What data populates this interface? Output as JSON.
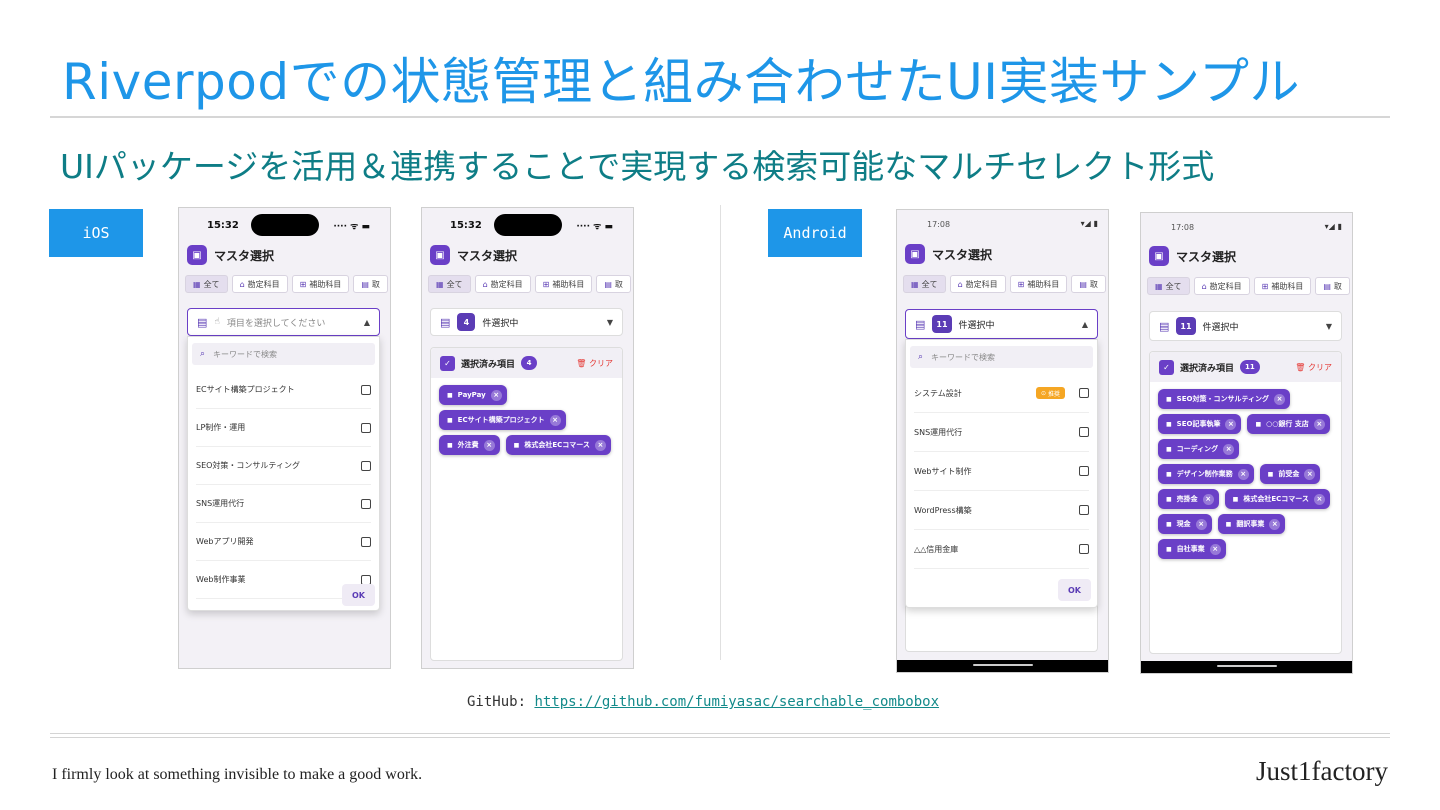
{
  "slide": {
    "title": "Riverpodでの状態管理と組み合わせたUI実装サンプル",
    "subtitle": "UIパッケージを活用＆連携することで実現する検索可能なマルチセレクト形式",
    "ios_label": "iOS",
    "android_label": "Android",
    "github_prefix": "GitHub: ",
    "github_link": "https://github.com/fumiyasac/searchable_combobox",
    "tagline": "I firmly look at something invisible to make a good work.",
    "brand": "Just1factory"
  },
  "app": {
    "title": "マスタ選択",
    "app_icon": "wallet-icon",
    "tabs": [
      {
        "icon": "grid-icon",
        "glyph": "▦",
        "label": "全て"
      },
      {
        "icon": "bank-icon",
        "glyph": "⌂",
        "label": "勘定科目"
      },
      {
        "icon": "hierarchy-icon",
        "glyph": "⊞",
        "label": "補助科目"
      },
      {
        "icon": "store-icon",
        "glyph": "▤",
        "label": "取"
      }
    ],
    "placeholder": "項目を選択してください",
    "search_placeholder": "キーワードで検索",
    "selected_suffix": "件選択中",
    "ok_label": "OK",
    "panel_title": "選択済み項目",
    "clear_label": "クリア",
    "recommend_badge": "推奨",
    "accent_color": "#6a3fc7"
  },
  "screens": {
    "ios_open": {
      "time": "15:32",
      "status_icons": "···· ᯤ ▬",
      "items": [
        "ECサイト構築プロジェクト",
        "LP制作・運用",
        "SEO対策・コンサルティング",
        "SNS運用代行",
        "Webアプリ開発",
        "Web制作事業"
      ]
    },
    "ios_selected": {
      "time": "15:32",
      "status_icons": "···· ᯤ ▬",
      "count": "4",
      "chips": [
        "PayPay",
        "ECサイト構築プロジェクト",
        "外注費",
        "株式会社ECコマース"
      ]
    },
    "android_open": {
      "time": "17:08",
      "status_icons": "▾◢ ▮",
      "count": "11",
      "items": [
        "システム設計",
        "SNS運用代行",
        "Webサイト制作",
        "WordPress構築",
        "△△信用金庫"
      ]
    },
    "android_selected": {
      "time": "17:08",
      "status_icons": "▾◢ ▮",
      "count": "11",
      "chips": [
        "SEO対策・コンサルティング",
        "SEO記事執筆",
        "○○銀行 支店",
        "コーディング",
        "デザイン制作業務",
        "前受金",
        "売掛金",
        "株式会社ECコマース",
        "現金",
        "翻訳事業",
        "自社事業"
      ]
    }
  }
}
